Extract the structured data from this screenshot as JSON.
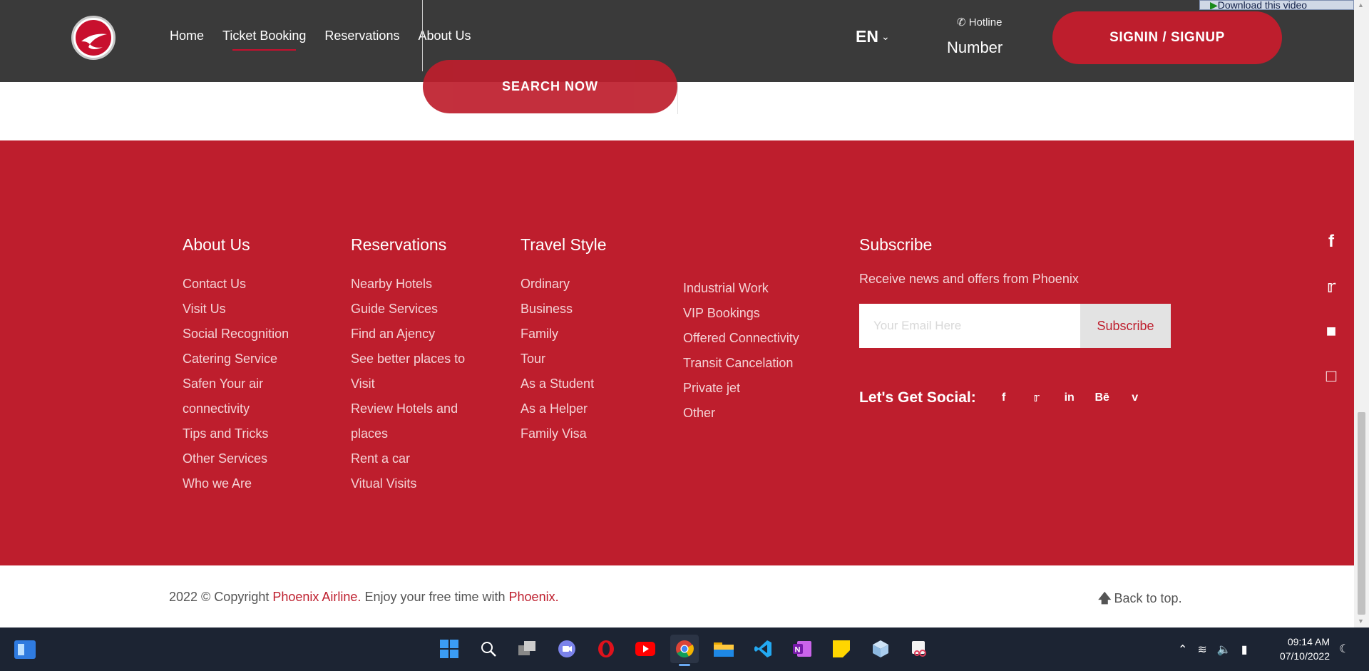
{
  "header": {
    "nav": [
      {
        "label": "Home",
        "active": false
      },
      {
        "label": "Ticket Booking",
        "active": true
      },
      {
        "label": "Reservations",
        "active": false
      },
      {
        "label": "About Us",
        "active": false
      }
    ],
    "language": "EN",
    "hotline_label": "Hotline",
    "hotline_number": "Number",
    "signin_label": "SIGNIN / SIGNUP",
    "download_badge": "Download this video"
  },
  "search": {
    "button_label": "SEARCH NOW"
  },
  "footer": {
    "about": {
      "title": "About Us",
      "items": [
        "Contact Us",
        "Visit Us",
        "Social Recognition",
        "Catering Service",
        "Safen Your air",
        "connectivity",
        "Tips and Tricks",
        "Other Services",
        "Who we Are"
      ]
    },
    "reservations": {
      "title": "Reservations",
      "items": [
        "Nearby Hotels",
        "Guide Services",
        "Find an Ajency",
        "See better places to",
        "Visit",
        "Review Hotels and",
        "places",
        "Rent a car",
        "Vitual Visits"
      ]
    },
    "travel_style": {
      "title": "Travel Style",
      "items": [
        "Ordinary",
        "Business",
        "Family",
        "Tour",
        "As a Student",
        "As a Helper",
        "Family Visa"
      ],
      "items2": [
        "Industrial Work",
        "VIP Bookings",
        "Offered Connectivity",
        "Transit Cancelation",
        "Private jet",
        "Other"
      ]
    },
    "subscribe": {
      "title": "Subscribe",
      "text": "Receive news and offers from Phoenix",
      "placeholder": "Your Email Here",
      "button": "Subscribe",
      "social_label": "Let's Get Social:",
      "social_icons": [
        "facebook-icon",
        "twitter-icon",
        "linkedin-icon",
        "behance-icon",
        "vimeo-icon"
      ]
    },
    "side_social": [
      "facebook-icon",
      "twitter-icon",
      "flickr-icon",
      "instagram-icon"
    ]
  },
  "bottom": {
    "copyright_prefix": "2022 © Copyright ",
    "brand": "Phoenix Airline.",
    "middle": " Enjoy your free time with ",
    "brand2": "Phoenix.",
    "back_to_top": "Back to top."
  },
  "taskbar": {
    "time": "09:14 AM",
    "date": "07/10/2022"
  },
  "colors": {
    "brand_red": "#be1e2d",
    "header_dark": "#3a3a3a",
    "taskbar": "#1c2433"
  }
}
